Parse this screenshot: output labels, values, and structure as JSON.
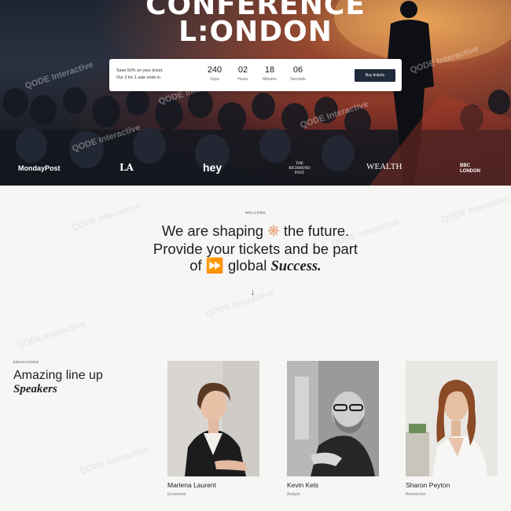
{
  "hero": {
    "title_line1": "CONFERENCE",
    "title_line2": "L:ONDON"
  },
  "ticket_bar": {
    "promo_line1": "Save 50% on your ticket.",
    "promo_line2": "Our 2 for 1 sale ends in",
    "countdown": [
      {
        "value": "240",
        "label": "Days"
      },
      {
        "value": "02",
        "label": "Hours"
      },
      {
        "value": "18",
        "label": "Minutes"
      },
      {
        "value": "06",
        "label": "Seconds"
      }
    ],
    "button_label": "Buy tickets"
  },
  "partners": [
    {
      "name": "MondayPost"
    },
    {
      "name": "LA"
    },
    {
      "name": "hey"
    },
    {
      "name": "THE RICHMOND POST"
    },
    {
      "name": "WEALTH"
    },
    {
      "name": "BBC LONDON"
    }
  ],
  "welcome": {
    "label": "WELCOME",
    "line1_a": "We are shaping",
    "line1_b": "the future.",
    "line2": "Provide your tickets and be part",
    "line3_a": "of",
    "line3_b": "global",
    "line3_c": "Success."
  },
  "speakers": {
    "label": "EDUCATORS",
    "title_line1": "Amazing line up",
    "title_line2": "Speakers",
    "items": [
      {
        "name": "Marlena Laurent",
        "role": "Economist"
      },
      {
        "name": "Kevin Kels",
        "role": "Analyst"
      },
      {
        "name": "Sharon Peyton",
        "role": "Researcher"
      }
    ]
  },
  "watermark": "QODE Interactive"
}
